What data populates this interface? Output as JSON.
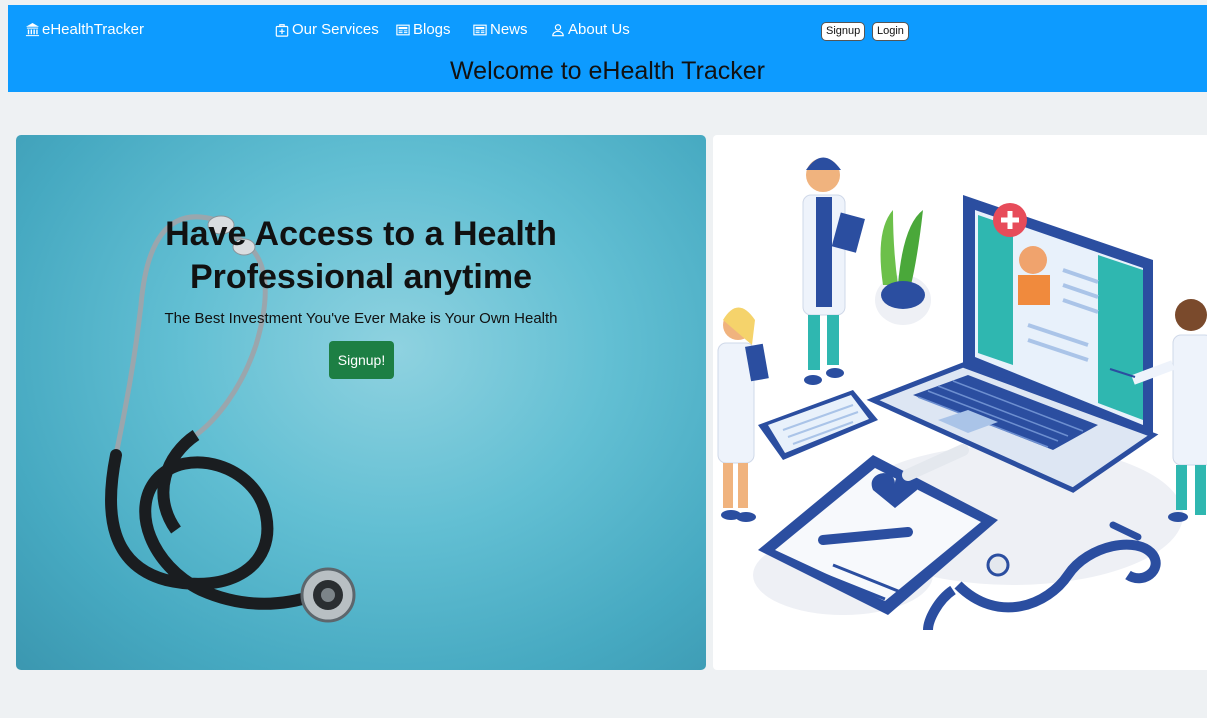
{
  "header": {
    "brand": "eHealthTracker",
    "nav": [
      {
        "label": "Our Services",
        "icon": "medical-bag-icon"
      },
      {
        "label": "Blogs",
        "icon": "newspaper-icon"
      },
      {
        "label": "News",
        "icon": "newspaper-icon"
      },
      {
        "label": "About Us",
        "icon": "person-icon"
      }
    ],
    "signup_label": "Signup",
    "login_label": "Login",
    "welcome": "Welcome to eHealth Tracker"
  },
  "hero": {
    "title": "Have Access to a Health Professional anytime",
    "subtitle": "The Best Investment You've Ever Make is Your Own Health",
    "cta_label": "Signup!"
  },
  "colors": {
    "header_bg": "#0d9bff",
    "cta_bg": "#1d7f44",
    "page_bg": "#eef1f3",
    "illustration_blue": "#2b4ea0",
    "illustration_teal": "#2fb7b0"
  }
}
